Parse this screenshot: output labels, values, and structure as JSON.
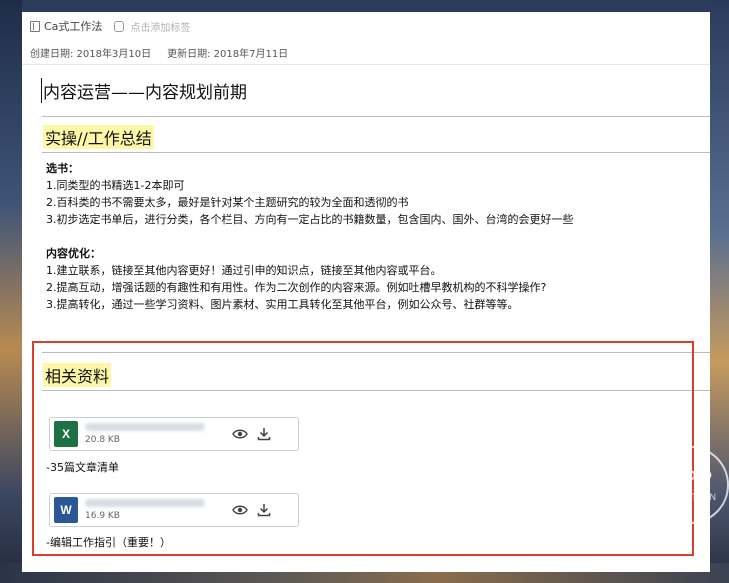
{
  "topbar": {
    "notebook_icon": "notebook-icon",
    "notebook_name": "Ca式工作法",
    "tag_icon": "tag-icon",
    "tag_placeholder": "点击添加标签"
  },
  "dates": {
    "created": "创建日期: 2018年3月10日",
    "updated": "更新日期: 2018年7月11日"
  },
  "note": {
    "title": "内容运营——内容规划前期",
    "section1": {
      "heading": "实操//工作总结",
      "block1_title": "选书：",
      "block1_lines": [
        "1.同类型的书精选1-2本即可",
        "2.百科类的书不需要太多，最好是针对某个主题研究的较为全面和透彻的书",
        "3.初步选定书单后，进行分类，各个栏目、方向有一定占比的书籍数量，包含国内、国外、台湾的会更好一些"
      ],
      "block2_title": "内容优化：",
      "block2_lines": [
        "1.建立联系，链接至其他内容更好！通过引申的知识点，链接至其他内容或平台。",
        "2.提高互动，增强话题的有趣性和有用性。作为二次创作的内容来源。例如吐槽早教机构的不科学操作?",
        "3.提高转化，通过一些学习资料、图片素材、实用工具转化至其他平台，例如公众号、社群等等。"
      ]
    },
    "section2": {
      "heading": "相关资料",
      "attachments": [
        {
          "icon": "excel-file-icon",
          "icon_letter": "X",
          "size": "20.8 KB",
          "caption": "-35篇文章清单"
        },
        {
          "icon": "word-file-icon",
          "icon_letter": "W",
          "size": "16.9 KB",
          "caption": "-编辑工作指引（重要！）"
        }
      ]
    }
  },
  "watermark": {
    "line1": "APP",
    "line2": "SOLUTION"
  },
  "colors": {
    "highlight": "#fdf7a8",
    "annotation_box": "#d9402a",
    "excel": "#1e7145",
    "word": "#2b5797"
  }
}
